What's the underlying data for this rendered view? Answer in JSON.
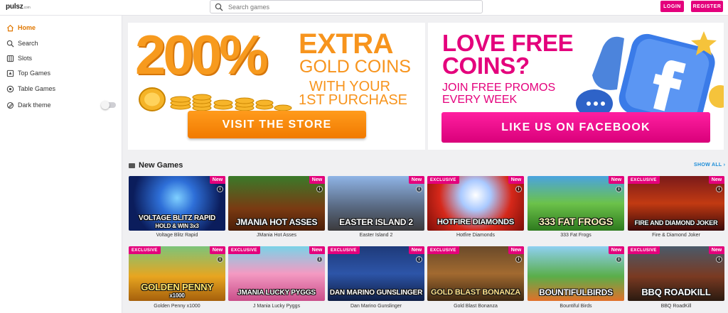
{
  "header": {
    "logo": "pulsz",
    "logo_domain": ".com",
    "search_placeholder": "Search games",
    "login_label": "LOGIN",
    "register_label": "REGISTER",
    "accent_color": "#e4007c"
  },
  "sidebar": {
    "items": [
      {
        "label": "Home",
        "icon": "home-icon",
        "active": true
      },
      {
        "label": "Search",
        "icon": "search-icon"
      },
      {
        "label": "Slots",
        "icon": "slots-icon"
      },
      {
        "label": "Top Games",
        "icon": "top-games-icon"
      },
      {
        "label": "Table Games",
        "icon": "table-games-icon"
      },
      {
        "label": "Dark theme",
        "icon": "dark-theme-icon",
        "toggle": false
      }
    ],
    "active_color": "#e07700"
  },
  "banners": {
    "store": {
      "big": "200%",
      "line1": "EXTRA",
      "line2": "GOLD COINS",
      "line3": "WITH YOUR",
      "line4": "1ST PURCHASE",
      "button": "VISIT THE STORE"
    },
    "facebook": {
      "line1": "LOVE FREE",
      "line2": "COINS?",
      "line3": "JOIN FREE PROMOS",
      "line4": "EVERY WEEK",
      "button": "LIKE US ON FACEBOOK"
    }
  },
  "section": {
    "title": "New Games",
    "show_all": "SHOW ALL"
  },
  "badges": {
    "new": "New",
    "exclusive": "EXCLUSIVE",
    "info": "i"
  },
  "games": [
    {
      "name": "Voltage Blitz Rapid",
      "art": "VOLTAGE BLITZ RAPID",
      "art2": "HOLD & WIN 3x3",
      "exclusive": false,
      "new": true
    },
    {
      "name": "JMania Hot Asses",
      "art": "JMANIA HOT ASSES",
      "exclusive": false,
      "new": true
    },
    {
      "name": "Easter Island 2",
      "art": "EASTER ISLAND 2",
      "exclusive": false,
      "new": true
    },
    {
      "name": "Hotfire Diamonds",
      "art": "HOTFIRE DIAMONDS",
      "exclusive": true,
      "new": true
    },
    {
      "name": "333 Fat Frogs",
      "art": "333 FAT FROGS",
      "exclusive": false,
      "new": true
    },
    {
      "name": "Fire & Diamond Joker",
      "art": "FIRE AND DIAMOND JOKER",
      "exclusive": true,
      "new": true
    },
    {
      "name": "Golden Penny x1000",
      "art": "GOLDEN PENNY",
      "art2": "x1000",
      "exclusive": true,
      "new": true
    },
    {
      "name": "J Mania Lucky Pyggs",
      "art": "JMANIA LUCKY PYGGS",
      "exclusive": true,
      "new": true
    },
    {
      "name": "Dan Marino Gunslinger",
      "art": "DAN MARINO GUNSLINGER",
      "exclusive": true,
      "new": true
    },
    {
      "name": "Gold Blast Bonanza",
      "art": "GOLD BLAST BONANZA",
      "exclusive": true,
      "new": true
    },
    {
      "name": "Bountiful Birds",
      "art": "BOUNTIFULBIRDS",
      "exclusive": false,
      "new": true
    },
    {
      "name": "BBQ RoadKill",
      "art": "BBQ ROADKILL",
      "exclusive": true,
      "new": true
    }
  ]
}
